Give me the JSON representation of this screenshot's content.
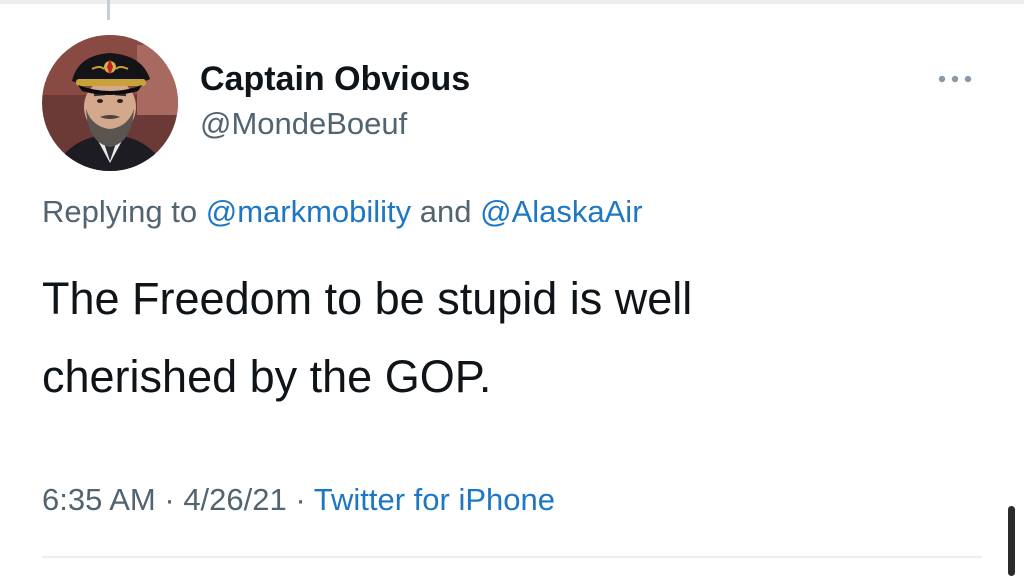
{
  "tweet": {
    "author": {
      "display_name": "Captain Obvious",
      "handle": "@MondeBoeuf",
      "avatar_icon": "captain-hat-portrait"
    },
    "more_icon": "more-horizontal-icon",
    "reply": {
      "prefix": "Replying to ",
      "mentions": [
        "@markmobility",
        "@AlaskaAir"
      ],
      "joiner": " and "
    },
    "text_lines": [
      "The Freedom to be stupid is well",
      "cherished by the GOP."
    ],
    "meta": {
      "time": "6:35 AM",
      "separator": " · ",
      "date": "4/26/21",
      "source": "Twitter for iPhone"
    },
    "colors": {
      "link": "#1d77c4",
      "secondary_text": "#536471",
      "primary_text": "#0f1419"
    }
  }
}
